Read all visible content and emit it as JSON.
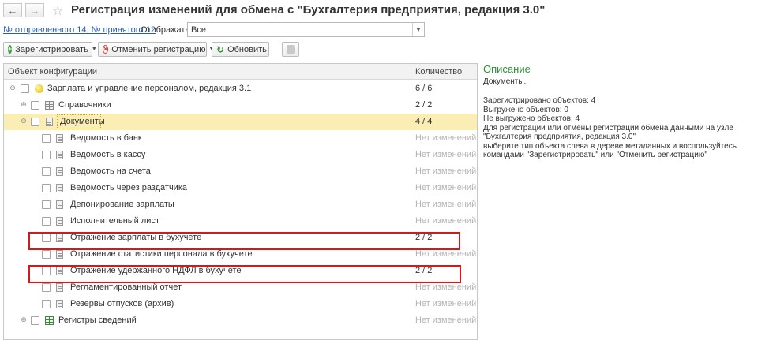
{
  "window": {
    "title": "Регистрация изменений для обмена с  \"Бухгалтерия предприятия, редакция 3.0\"",
    "back_icon": "←",
    "forward_icon": "→",
    "favorite_icon": "☆"
  },
  "info": {
    "message_numbers_link": "№ отправленного 14, № принятого 12",
    "show_label": "Отображать:",
    "show_value": "Все",
    "dropdown_icon": "▼"
  },
  "toolbar": {
    "register_label": "Зарегистрировать",
    "cancel_label": "Отменить регистрацию",
    "refresh_label": "Обновить",
    "register_icon": "+",
    "cancel_icon": "×",
    "refresh_icon": "↻",
    "caret": "▼"
  },
  "tree": {
    "col_object": "Объект конфигурации",
    "col_qty": "Количество",
    "expand_symbol": "⊖",
    "collapsed_symbol": "⊕",
    "rows": [
      {
        "name": "Зарплата и управление персоналом, редакция 3.1",
        "qty": "6 / 6"
      },
      {
        "name": "Справочники",
        "qty": "2 / 2"
      },
      {
        "name": "Документы",
        "qty": "4 / 4"
      },
      {
        "name": "Ведомость в банк",
        "qty": "Нет изменений"
      },
      {
        "name": "Ведомость в кассу",
        "qty": "Нет изменений"
      },
      {
        "name": "Ведомость на счета",
        "qty": "Нет изменений"
      },
      {
        "name": "Ведомость через раздатчика",
        "qty": "Нет изменений"
      },
      {
        "name": "Депонирование зарплаты",
        "qty": "Нет изменений"
      },
      {
        "name": "Исполнительный лист",
        "qty": "Нет изменений"
      },
      {
        "name": "Отражение зарплаты в бухучете",
        "qty": "2 / 2"
      },
      {
        "name": "Отражение статистики персонала в бухучете",
        "qty": "Нет изменений"
      },
      {
        "name": "Отражение удержанного НДФЛ в бухучете",
        "qty": "2 / 2"
      },
      {
        "name": "Регламентированный отчет",
        "qty": "Нет изменений"
      },
      {
        "name": "Резервы отпусков (архив)",
        "qty": "Нет изменений"
      },
      {
        "name": "Регистры сведений",
        "qty": "Нет изменений"
      }
    ]
  },
  "description": {
    "title": "Описание",
    "subtitle": "Документы.",
    "lines": [
      "Зарегистрировано объектов: 4",
      "Выгружено объектов: 0",
      "Не выгружено объектов: 4",
      "Для регистрации или отмены регистрации обмена данными на узле",
      "\"Бухгалтерия предприятия, редакция 3.0\"",
      "выберите тип объекта слева в дереве метаданных и воспользуйтесь",
      "командами \"Зарегистрировать\" или \"Отменить регистрацию\""
    ]
  },
  "colors": {
    "accent_green": "#2f8f3a",
    "link_blue": "#2b5dab",
    "selection": "#fbeeb4",
    "highlight_red": "#d21a1a",
    "muted": "#b3b3b3"
  }
}
